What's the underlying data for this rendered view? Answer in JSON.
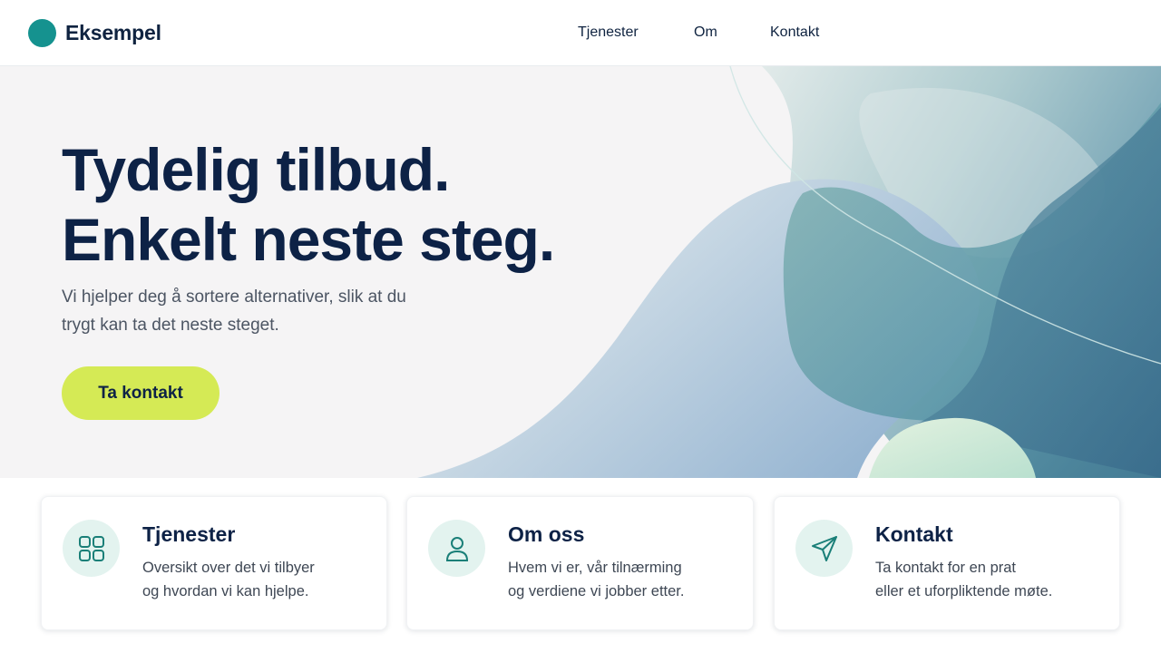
{
  "brand": {
    "name": "Eksempel",
    "logo_color": "#15928f"
  },
  "nav": {
    "items": [
      {
        "label": "Tjenester"
      },
      {
        "label": "Om"
      },
      {
        "label": "Kontakt"
      }
    ]
  },
  "hero": {
    "title_line1": "Tydelig tilbud.",
    "title_line2": "Enkelt neste steg.",
    "subtitle_line1": "Vi hjelper deg å sortere alternativer, slik at du",
    "subtitle_line2": "trygt kan ta det neste steget.",
    "cta_label": "Ta kontakt",
    "cta_color": "#d5ea55"
  },
  "cards": [
    {
      "icon": "grid-icon",
      "title": "Tjenester",
      "desc_line1": "Oversikt over det vi tilbyer",
      "desc_line2": "og hvordan vi kan hjelpe."
    },
    {
      "icon": "user-icon",
      "title": "Om oss",
      "desc_line1": "Hvem vi er, vår tilnærming",
      "desc_line2": "og verdiene vi jobber etter."
    },
    {
      "icon": "send-icon",
      "title": "Kontakt",
      "desc_line1": "Ta kontakt for en prat",
      "desc_line2": "eller et uforpliktende møte."
    }
  ],
  "colors": {
    "heading": "#0d2246",
    "accent_teal": "#15928f",
    "icon_bg": "#e3f3ef"
  }
}
